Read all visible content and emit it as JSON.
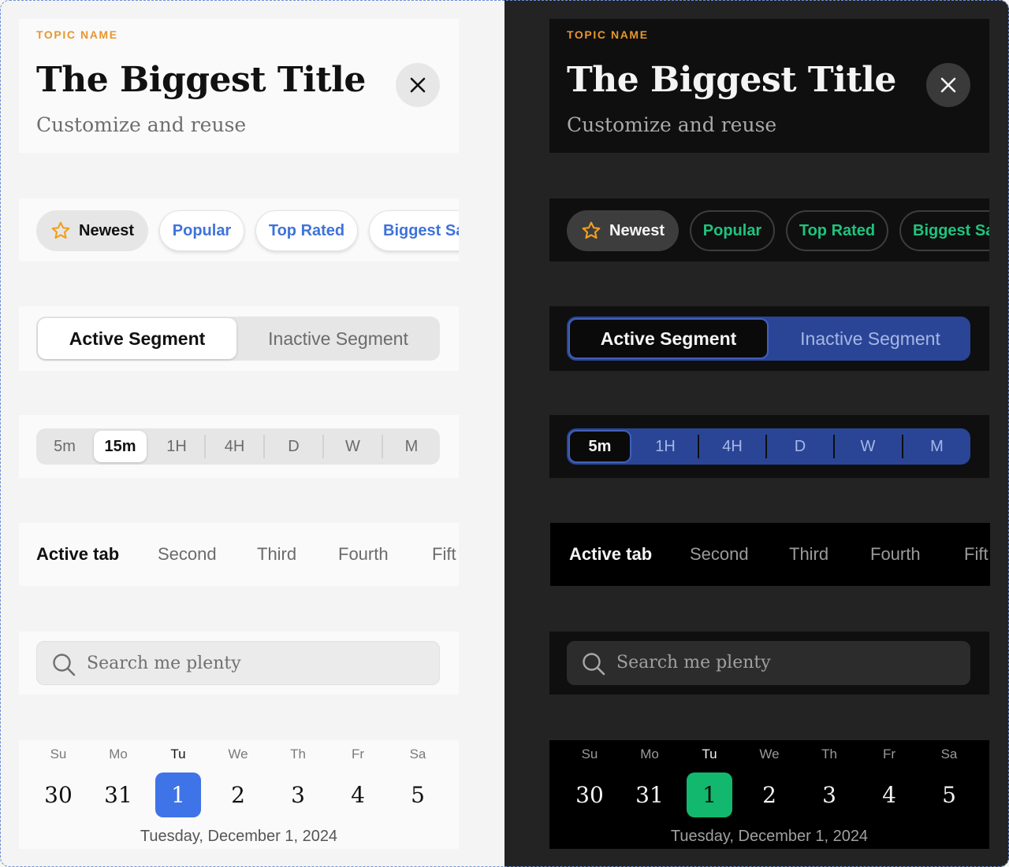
{
  "colors": {
    "topic_accent": "#e8962e",
    "light_link_blue": "#3f73d9",
    "dark_link_green": "#1fc37d",
    "dark_segment_blue": "#2a4596",
    "light_selected_day": "#3f73e8",
    "dark_selected_day": "#12b86d"
  },
  "icons": {
    "close": "close-icon",
    "star": "star-icon",
    "search": "search-icon"
  },
  "light": {
    "header": {
      "topic": "TOPIC NAME",
      "title": "The Biggest Title",
      "subtitle": "Customize and reuse"
    },
    "chips": [
      "Newest",
      "Popular",
      "Top Rated",
      "Biggest Sa"
    ],
    "segment": {
      "active": "Active Segment",
      "inactive": "Inactive Segment"
    },
    "timeframes": {
      "items": [
        "5m",
        "15m",
        "1H",
        "4H",
        "D",
        "W",
        "M"
      ],
      "selected": "15m"
    },
    "tabs": [
      "Active tab",
      "Second",
      "Third",
      "Fourth",
      "Fift"
    ],
    "search": {
      "placeholder": "Search me plenty"
    },
    "calendar": {
      "weekdays": [
        "Su",
        "Mo",
        "Tu",
        "We",
        "Th",
        "Fr",
        "Sa"
      ],
      "days": [
        "30",
        "31",
        "1",
        "2",
        "3",
        "4",
        "5"
      ],
      "selected": "1",
      "date_label": "Tuesday, December 1, 2024"
    }
  },
  "dark": {
    "header": {
      "topic": "TOPIC NAME",
      "title": "The Biggest Title",
      "subtitle": "Customize and reuse"
    },
    "chips": [
      "Newest",
      "Popular",
      "Top Rated",
      "Biggest Sa"
    ],
    "segment": {
      "active": "Active Segment",
      "inactive": "Inactive Segment"
    },
    "timeframes": {
      "items": [
        "5m",
        "1H",
        "4H",
        "D",
        "W",
        "M"
      ],
      "selected": "5m"
    },
    "tabs": [
      "Active tab",
      "Second",
      "Third",
      "Fourth",
      "Fift"
    ],
    "search": {
      "placeholder": "Search me plenty"
    },
    "calendar": {
      "weekdays": [
        "Su",
        "Mo",
        "Tu",
        "We",
        "Th",
        "Fr",
        "Sa"
      ],
      "days": [
        "30",
        "31",
        "1",
        "2",
        "3",
        "4",
        "5"
      ],
      "selected": "1",
      "date_label": "Tuesday, December 1, 2024"
    }
  }
}
